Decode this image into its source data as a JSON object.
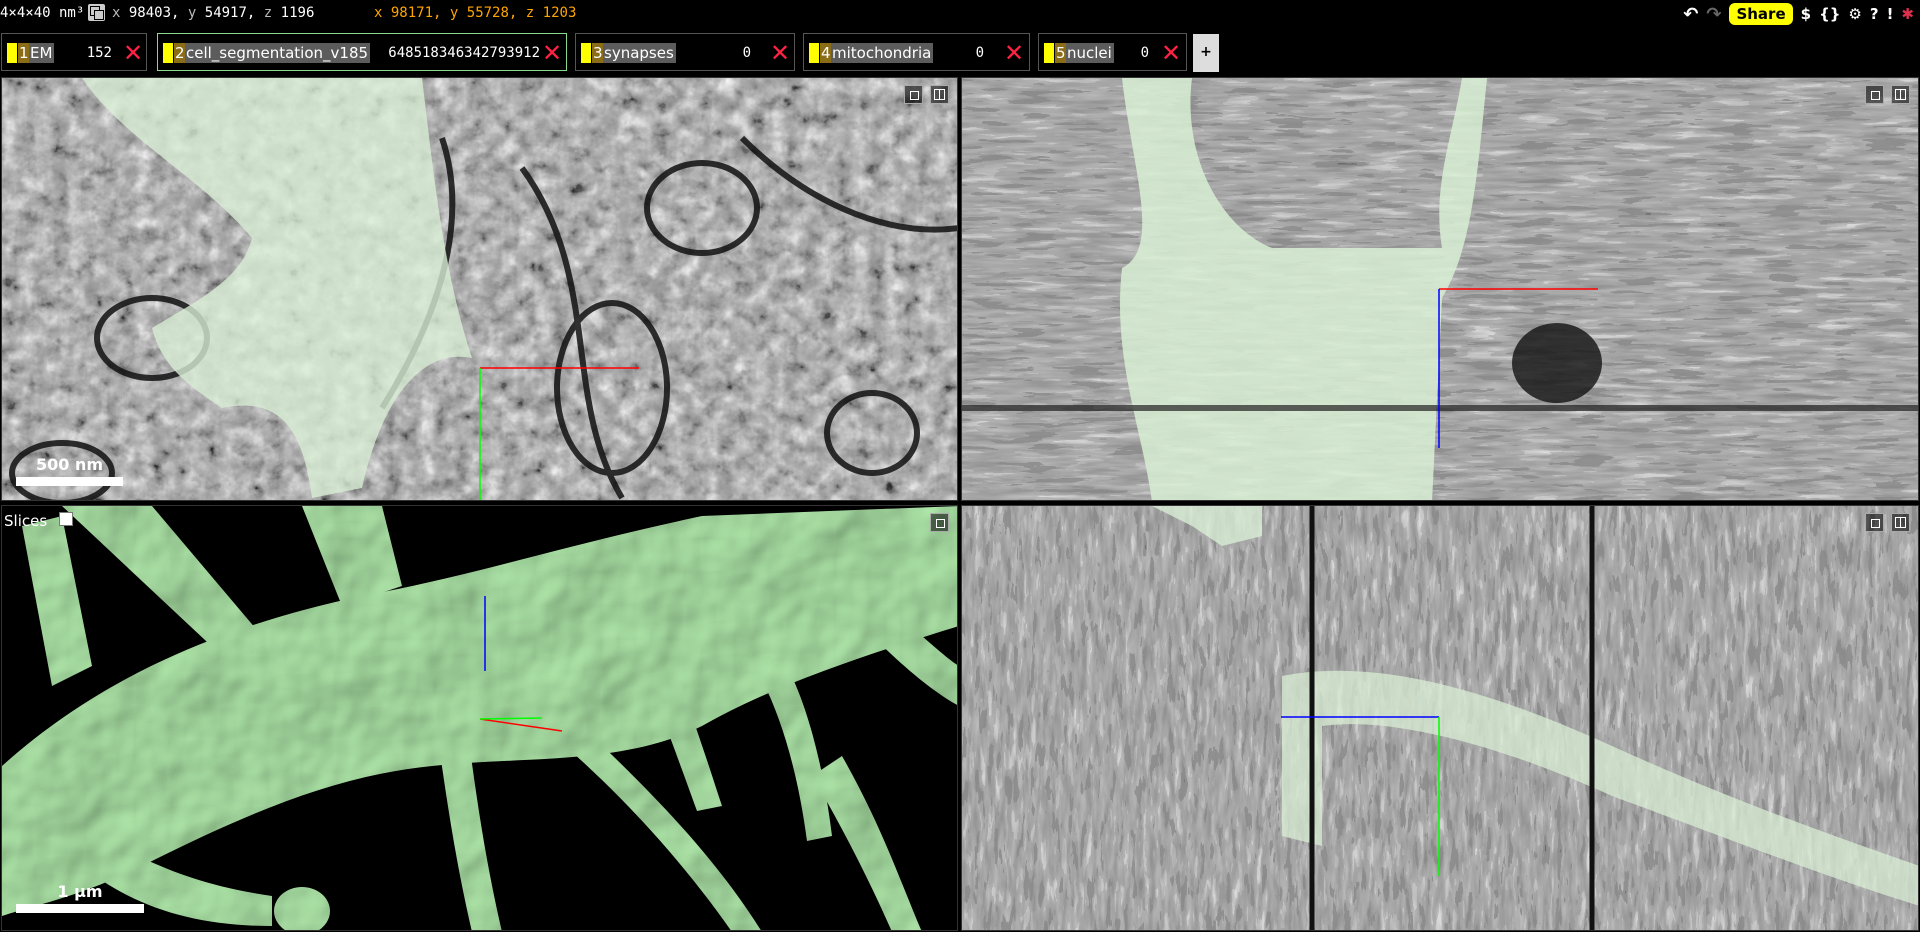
{
  "status": {
    "voxel_size": "4×4×40 nm³",
    "position": {
      "x_label": "x",
      "x": "98403,",
      "y_label": "y",
      "y": "54917,",
      "z_label": "z",
      "z": "1196"
    },
    "mouse": {
      "x_label": "x",
      "x": "98171,",
      "y_label": "y",
      "y": "55728,",
      "z_label": "z",
      "z": "1203"
    }
  },
  "toolbar": {
    "share_label": "Share",
    "dollar_label": "$",
    "json_label": "{}",
    "help_label": "?",
    "warning_label": "!"
  },
  "layers": [
    {
      "num": "1",
      "name": "EM",
      "value": "152",
      "selected": false
    },
    {
      "num": "2",
      "name": "cell_segmentation_v185",
      "value": "648518346342793912",
      "selected": true
    },
    {
      "num": "3",
      "name": "synapses",
      "value": "0",
      "selected": false
    },
    {
      "num": "4",
      "name": "mitochondria",
      "value": "0",
      "selected": false
    },
    {
      "num": "5",
      "name": "nuclei",
      "value": "0",
      "selected": false
    }
  ],
  "add_layer_label": "+",
  "panels": {
    "xy": {
      "scale_label": "500 nm"
    },
    "view3d": {
      "slices_label": "Slices",
      "slices_checked": false,
      "scale_label": "1 µm"
    }
  },
  "colors": {
    "accent": "#ffff00",
    "segment": "#a8e6a8",
    "mouse_coord": "#ffa500",
    "close": "#ff2244",
    "axis_x": "#ff0000",
    "axis_y": "#00ff00",
    "axis_z": "#0000ff"
  }
}
